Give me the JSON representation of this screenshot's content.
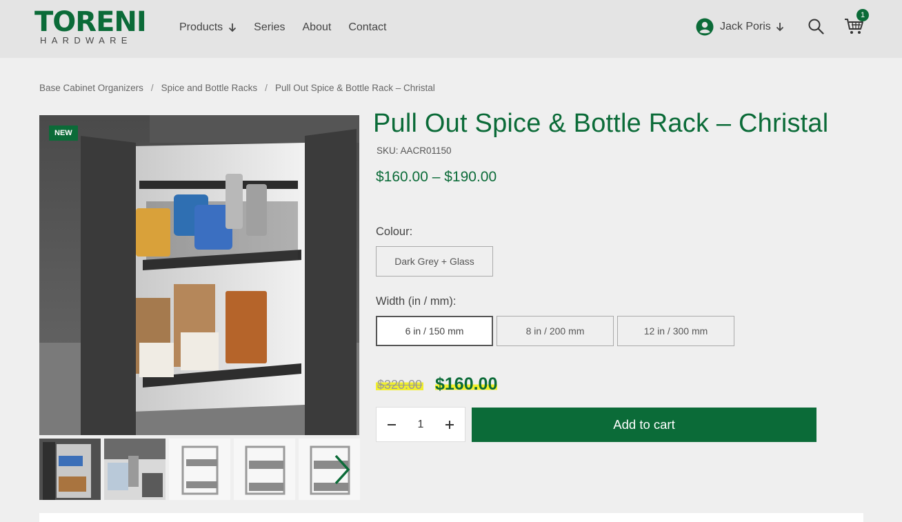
{
  "header": {
    "logo_main": "TORENI",
    "logo_sub": "HARDWARE",
    "nav": [
      {
        "label": "Products",
        "has_dropdown": true
      },
      {
        "label": "Series",
        "has_dropdown": false
      },
      {
        "label": "About",
        "has_dropdown": false
      },
      {
        "label": "Contact",
        "has_dropdown": false
      }
    ],
    "user_name": "Jack Poris",
    "cart_count": "1"
  },
  "breadcrumb": {
    "items": [
      "Base Cabinet Organizers",
      "Spice and Bottle Racks",
      "Pull Out Spice & Bottle Rack – Christal"
    ],
    "separator": "/"
  },
  "product": {
    "badge": "NEW",
    "title": "Pull Out Spice & Bottle Rack – Christal",
    "sku": "SKU: AACR01150",
    "price_range": "$160.00 – $190.00",
    "colour_label": "Colour:",
    "colours": [
      "Dark Grey + Glass"
    ],
    "width_label": "Width (in / mm):",
    "widths": [
      "6 in / 150 mm",
      "8 in / 200 mm",
      "12 in / 300 mm"
    ],
    "selected_width": "6 in / 150 mm",
    "old_price": "$320.00",
    "price": "$160.00",
    "quantity": "1",
    "add_to_cart": "Add to cart"
  },
  "colors": {
    "brand_green": "#0b6b38",
    "highlight": "#f2f02c"
  },
  "icons": {
    "user": "user-circle-icon",
    "search": "search-icon",
    "cart": "cart-icon",
    "next": "chevron-right-icon"
  }
}
